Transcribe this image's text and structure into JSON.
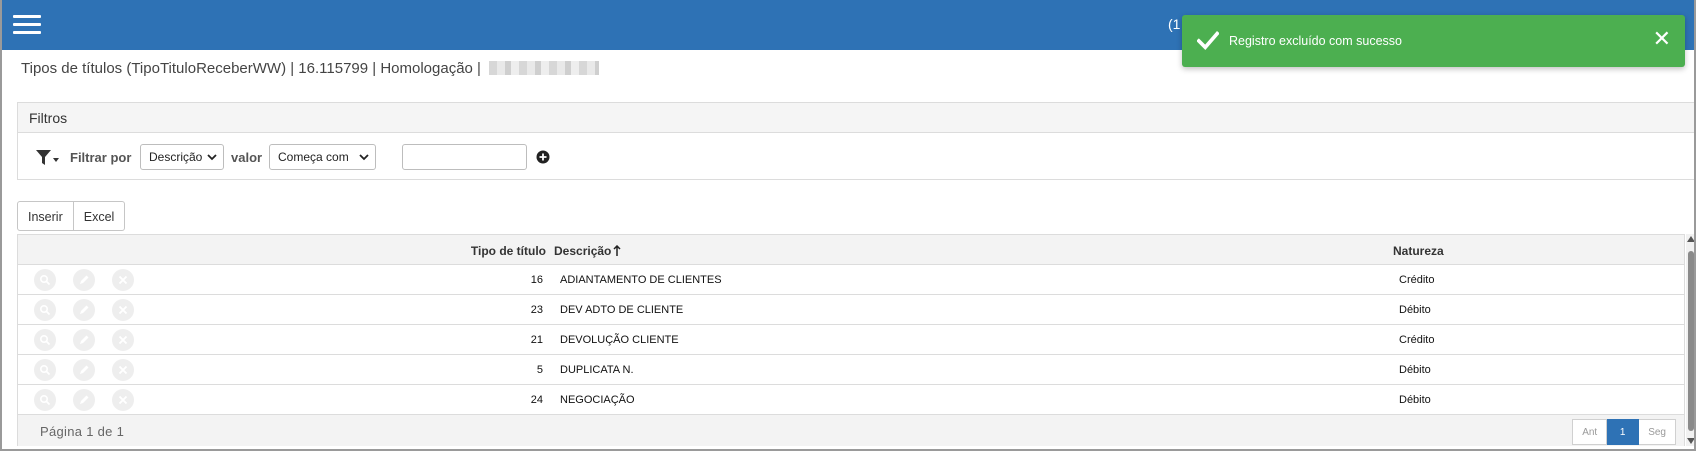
{
  "topbar": {
    "partial_text": "(1",
    "color": "#2e72b5"
  },
  "toast": {
    "message": "Registro excluído com sucesso",
    "close_symbol": "✕",
    "color": "#4caf50"
  },
  "breadcrumb": {
    "text": "Tipos de títulos (TipoTituloReceberWW) | 16.115799 | Homologação |"
  },
  "filters": {
    "title": "Filtros",
    "filter_by_label": "Filtrar por",
    "field_selected": "Descrição",
    "value_label": "valor",
    "operator_selected": "Começa com",
    "value_input": ""
  },
  "toolbar": {
    "insert_label": "Inserir",
    "excel_label": "Excel"
  },
  "table": {
    "columns": {
      "tipo": "Tipo de título",
      "descricao": "Descrição",
      "natureza": "Natureza"
    },
    "rows": [
      {
        "code": "16",
        "descricao": "ADIANTAMENTO DE CLIENTES",
        "natureza": "Crédito"
      },
      {
        "code": "23",
        "descricao": "DEV ADTO DE CLIENTE",
        "natureza": "Débito"
      },
      {
        "code": "21",
        "descricao": "DEVOLUÇÃO CLIENTE",
        "natureza": "Crédito"
      },
      {
        "code": "5",
        "descricao": "DUPLICATA N.",
        "natureza": "Débito"
      },
      {
        "code": "24",
        "descricao": "NEGOCIAÇÃO",
        "natureza": "Débito"
      }
    ],
    "row_actions": [
      "search-icon",
      "pencil-icon",
      "close-icon"
    ]
  },
  "footer": {
    "page_info": "Página 1 de 1",
    "prev_label": "Ant",
    "current_page": "1",
    "next_label": "Seg"
  }
}
